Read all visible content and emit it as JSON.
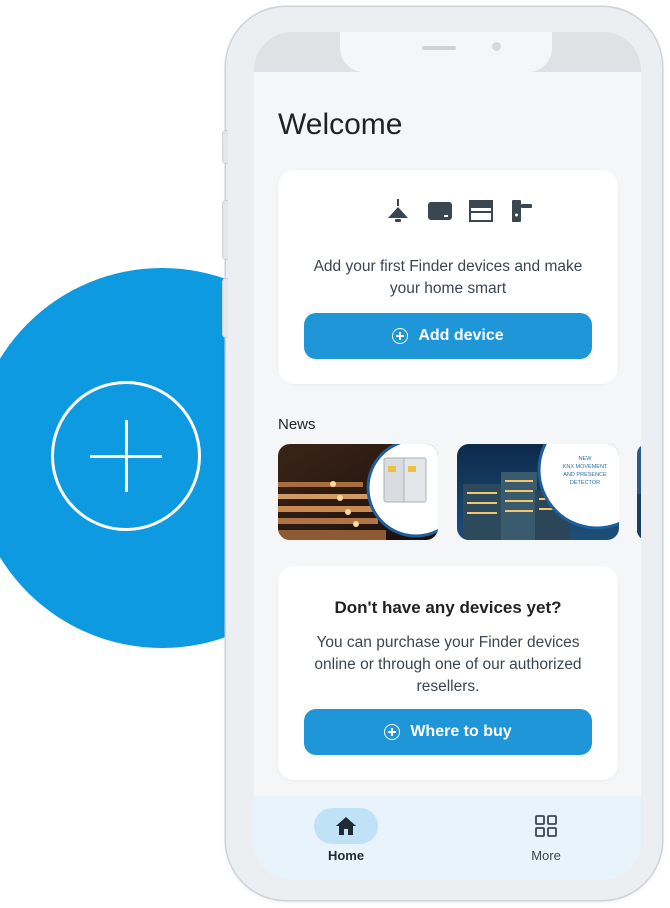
{
  "colors": {
    "accent": "#1e96d8",
    "brand_circle": "#0e9ae0",
    "home_pill": "#bfe2f6",
    "screen_bg": "#f5f6f8"
  },
  "header": {
    "title": "Welcome"
  },
  "welcome_card": {
    "device_icons": [
      "ceiling-lamp-icon",
      "tablet-device-icon",
      "shutter-icon",
      "door-handle-icon"
    ],
    "text": "Add your first Finder devices and make your home smart",
    "button_label": "Add device"
  },
  "news": {
    "label": "News",
    "items": [
      {
        "image": "illuminated-stairs-with-relay-module"
      },
      {
        "image": "office-buildings-night",
        "caption": "NEW KNX MOVEMENT AND PRESENCE DETECTOR"
      },
      {
        "image": "partial-news-card"
      }
    ]
  },
  "buy_card": {
    "title": "Don't have any devices yet?",
    "text": "You can purchase your Finder devices online or through one of our authorized resellers.",
    "button_label": "Where to buy"
  },
  "bottom_nav": {
    "items": [
      {
        "label": "Home",
        "icon": "home-icon",
        "active": true
      },
      {
        "label": "More",
        "icon": "grid-icon",
        "active": false
      }
    ]
  },
  "overlay": {
    "icon": "plus-circle-icon"
  }
}
